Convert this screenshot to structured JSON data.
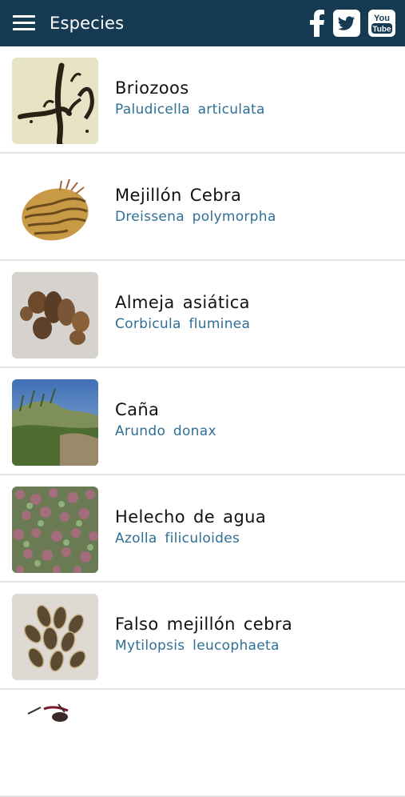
{
  "app_bar": {
    "title": "Especies",
    "colors": {
      "background": "#163a52",
      "foreground": "#ffffff"
    },
    "icons": [
      "menu-icon",
      "facebook-icon",
      "twitter-icon",
      "youtube-icon"
    ],
    "youtube_label_top": "You",
    "youtube_label_bottom": "Tube"
  },
  "species": [
    {
      "name": "Briozoos",
      "scientific": "Paludicella articulata"
    },
    {
      "name": "Mejillón Cebra",
      "scientific": "Dreissena polymorpha"
    },
    {
      "name": "Almeja asiática",
      "scientific": "Corbicula fluminea"
    },
    {
      "name": "Caña",
      "scientific": "Arundo donax"
    },
    {
      "name": "Helecho de agua",
      "scientific": "Azolla filiculoides"
    },
    {
      "name": "Falso mejillón cebra",
      "scientific": "Mytilopsis leucophaeta"
    }
  ],
  "colors": {
    "name_text": "#111111",
    "scientific_text": "#2f6f96",
    "divider": "#e3e3e3"
  }
}
